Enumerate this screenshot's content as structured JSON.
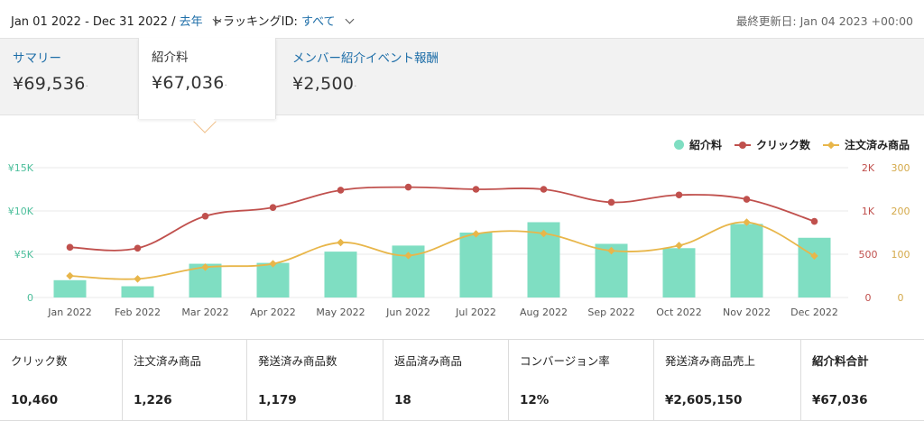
{
  "filters": {
    "date_range": "Jan 01 2022 - Dec 31 2022 /",
    "period": "去年",
    "tracking_label": "トラッキングID:",
    "tracking_value": "すべて",
    "last_updated": "最終更新日: Jan 04 2023 +00:00"
  },
  "summary_tabs": [
    {
      "label": "サマリー",
      "value": "¥69,536",
      "dot": "·"
    },
    {
      "label": "紹介料",
      "value": "¥67,036",
      "dot": "·"
    },
    {
      "label": "メンバー紹介イベント報酬",
      "value": "¥2,500",
      "dot": "·"
    }
  ],
  "colors": {
    "bar": "#7fdec2",
    "clicks": "#c0504d",
    "orders": "#e8b64a",
    "left_axis": "#4dbf9c",
    "mid_axis": "#c0504d",
    "right_axis": "#d4a94a",
    "link": "#1e6ea8"
  },
  "chart_data": {
    "type": "bar",
    "categories": [
      "Jan 2022",
      "Feb 2022",
      "Mar 2022",
      "Apr 2022",
      "May 2022",
      "Jun 2022",
      "Jul 2022",
      "Aug 2022",
      "Sep 2022",
      "Oct 2022",
      "Nov 2022",
      "Dec 2022"
    ],
    "series": [
      {
        "name": "紹介料",
        "type": "bar",
        "axis": "left",
        "values": [
          2000,
          1300,
          3900,
          4000,
          5300,
          6000,
          7500,
          8700,
          6200,
          5700,
          8500,
          6900
        ]
      },
      {
        "name": "クリック数",
        "type": "line",
        "axis": "mid",
        "values": [
          580,
          570,
          940,
          1080,
          1480,
          1550,
          1500,
          1500,
          1200,
          1370,
          1270,
          880
        ]
      },
      {
        "name": "注文済み商品",
        "type": "line",
        "axis": "right",
        "values": [
          50,
          43,
          70,
          78,
          127,
          97,
          147,
          148,
          108,
          120,
          174,
          96
        ]
      }
    ],
    "axes": {
      "left": {
        "range": [
          0,
          15000
        ],
        "ticks": [
          "0",
          "¥5K",
          "¥10K",
          "¥15K"
        ]
      },
      "mid": {
        "range": [
          0,
          3000
        ],
        "ticks": [
          "0",
          "500",
          "1K",
          "2K"
        ]
      },
      "right": {
        "range": [
          0,
          300
        ],
        "ticks": [
          "0",
          "100",
          "200",
          "300"
        ]
      }
    },
    "legend": [
      "紹介料",
      "クリック数",
      "注文済み商品"
    ],
    "legend_position": "top-right",
    "grid": true
  },
  "stats": [
    {
      "label": "クリック数",
      "value": "10,460"
    },
    {
      "label": "注文済み商品",
      "value": "1,226"
    },
    {
      "label": "発送済み商品数",
      "value": "1,179"
    },
    {
      "label": "返品済み商品",
      "value": "18"
    },
    {
      "label": "コンバージョン率",
      "value": "12%"
    },
    {
      "label": "発送済み商品売上",
      "value": "¥2,605,150"
    },
    {
      "label": "紹介料合計",
      "value": "¥67,036"
    }
  ]
}
